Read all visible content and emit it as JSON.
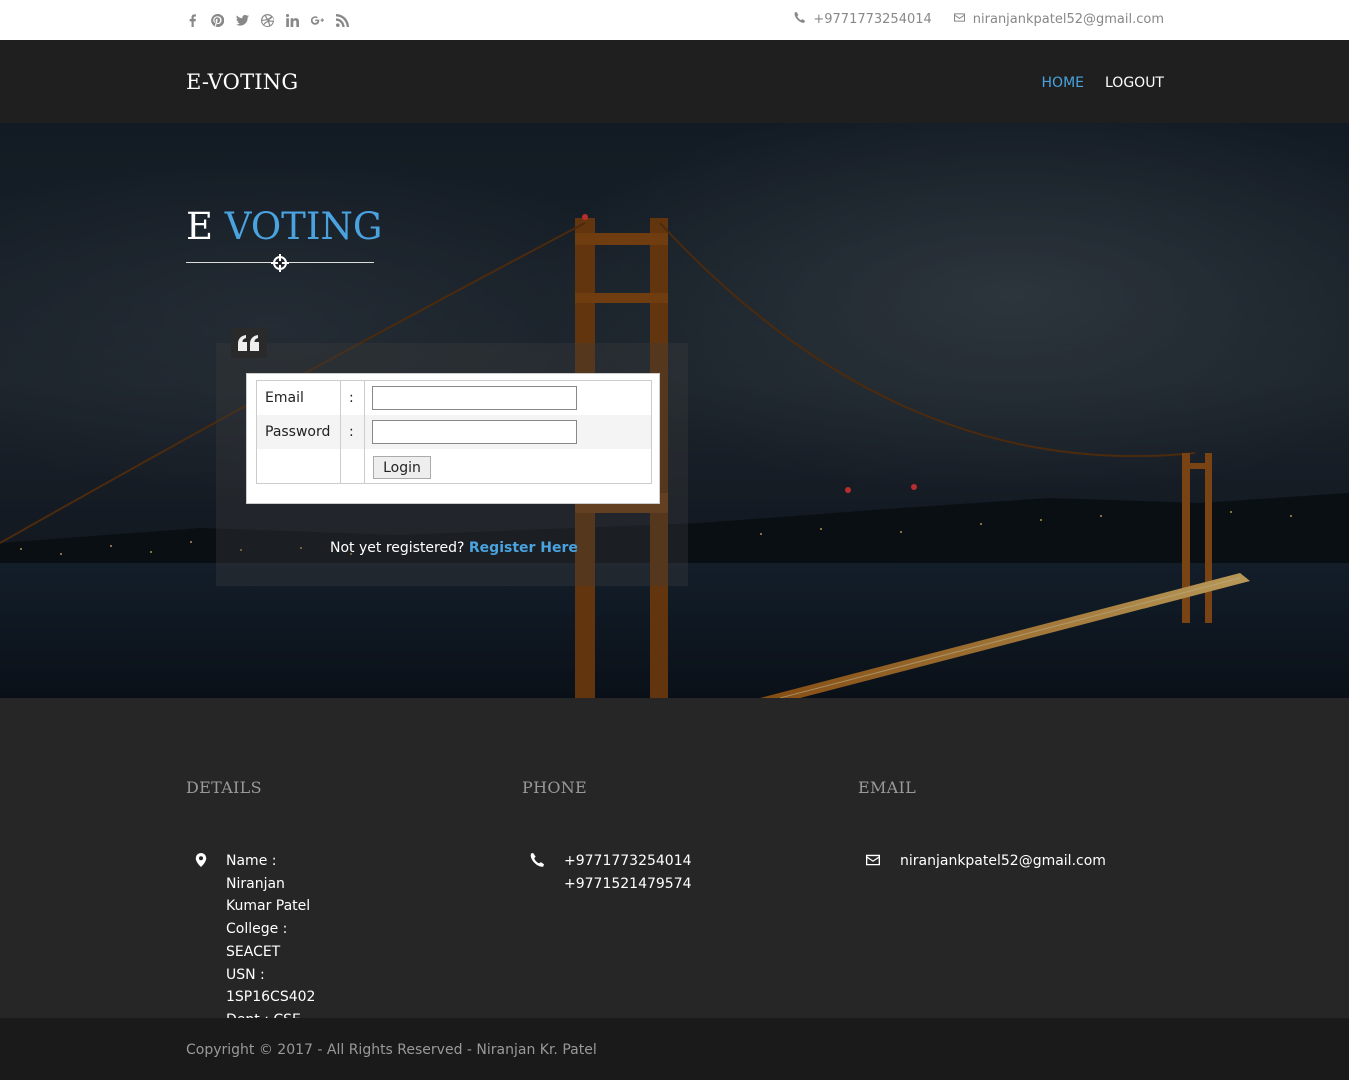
{
  "topbar": {
    "social": [
      "facebook-icon",
      "pinterest-icon",
      "twitter-icon",
      "dribbble-icon",
      "linkedin-icon",
      "google-plus-icon",
      "rss-icon"
    ],
    "phone": "+9771773254014",
    "email": "niranjankpatel52@gmail.com"
  },
  "navbar": {
    "brand": "E-VOTING",
    "links": [
      {
        "label": "HOME",
        "active": true
      },
      {
        "label": "LOGOUT",
        "active": false
      }
    ]
  },
  "hero": {
    "title_main": "E",
    "title_accent": "VOTING",
    "form": {
      "email_label": "Email",
      "password_label": "Password",
      "colon": ":",
      "email_value": "",
      "password_value": "",
      "login_button": "Login"
    },
    "register_prefix": "Not yet registered?",
    "register_link": "Register Here"
  },
  "footer": {
    "details": {
      "heading": "DETAILS",
      "lines": [
        "Name : Niranjan Kumar Patel",
        "College : SEACET",
        "USN : 1SP16CS402",
        "Dept : CSE"
      ]
    },
    "phone": {
      "heading": "PHONE",
      "lines": [
        "+9771773254014",
        "+9771521479574"
      ]
    },
    "email": {
      "heading": "EMAIL",
      "lines": [
        "niranjankpatel52@gmail.com"
      ]
    },
    "copyright": "Copyright © 2017 - All Rights Reserved - Niranjan Kr. Patel"
  },
  "colors": {
    "accent": "#4aa3df",
    "navbar": "#1f1f1f",
    "footer": "#262626"
  }
}
